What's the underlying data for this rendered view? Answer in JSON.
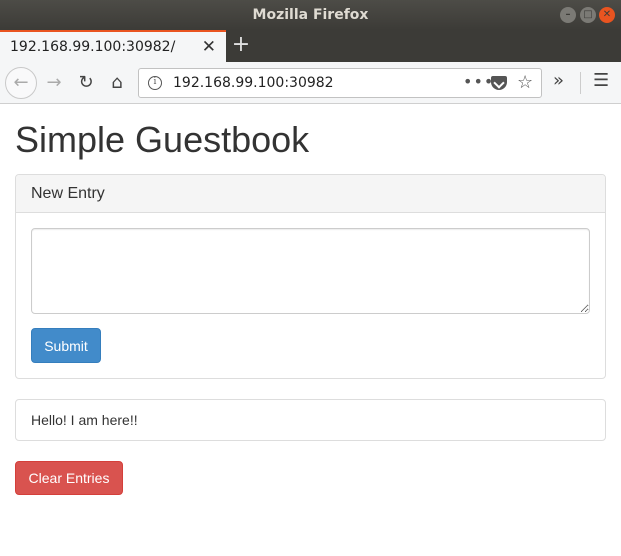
{
  "window": {
    "title": "Mozilla Firefox",
    "minimize_glyph": "–",
    "maximize_glyph": "□",
    "close_glyph": "✕"
  },
  "tab": {
    "label": "192.168.99.100:30982/",
    "close_glyph": "✕",
    "new_tab_glyph": "+"
  },
  "navbar": {
    "back_glyph": "←",
    "forward_glyph": "→",
    "reload_glyph": "↻",
    "home_glyph": "⌂",
    "info_glyph": "i",
    "url": "192.168.99.100:30982",
    "more_glyph": "•••",
    "star_glyph": "☆",
    "overflow_glyph": "»",
    "menu_glyph": "☰"
  },
  "page": {
    "title": "Simple Guestbook",
    "panel_heading": "New Entry",
    "textarea_value": "",
    "submit_label": "Submit",
    "entries": [
      "Hello! I am here!!"
    ],
    "clear_label": "Clear Entries"
  },
  "colors": {
    "accent_orange": "#e95420",
    "submit_blue": "#428bca",
    "clear_red": "#d9534f"
  }
}
